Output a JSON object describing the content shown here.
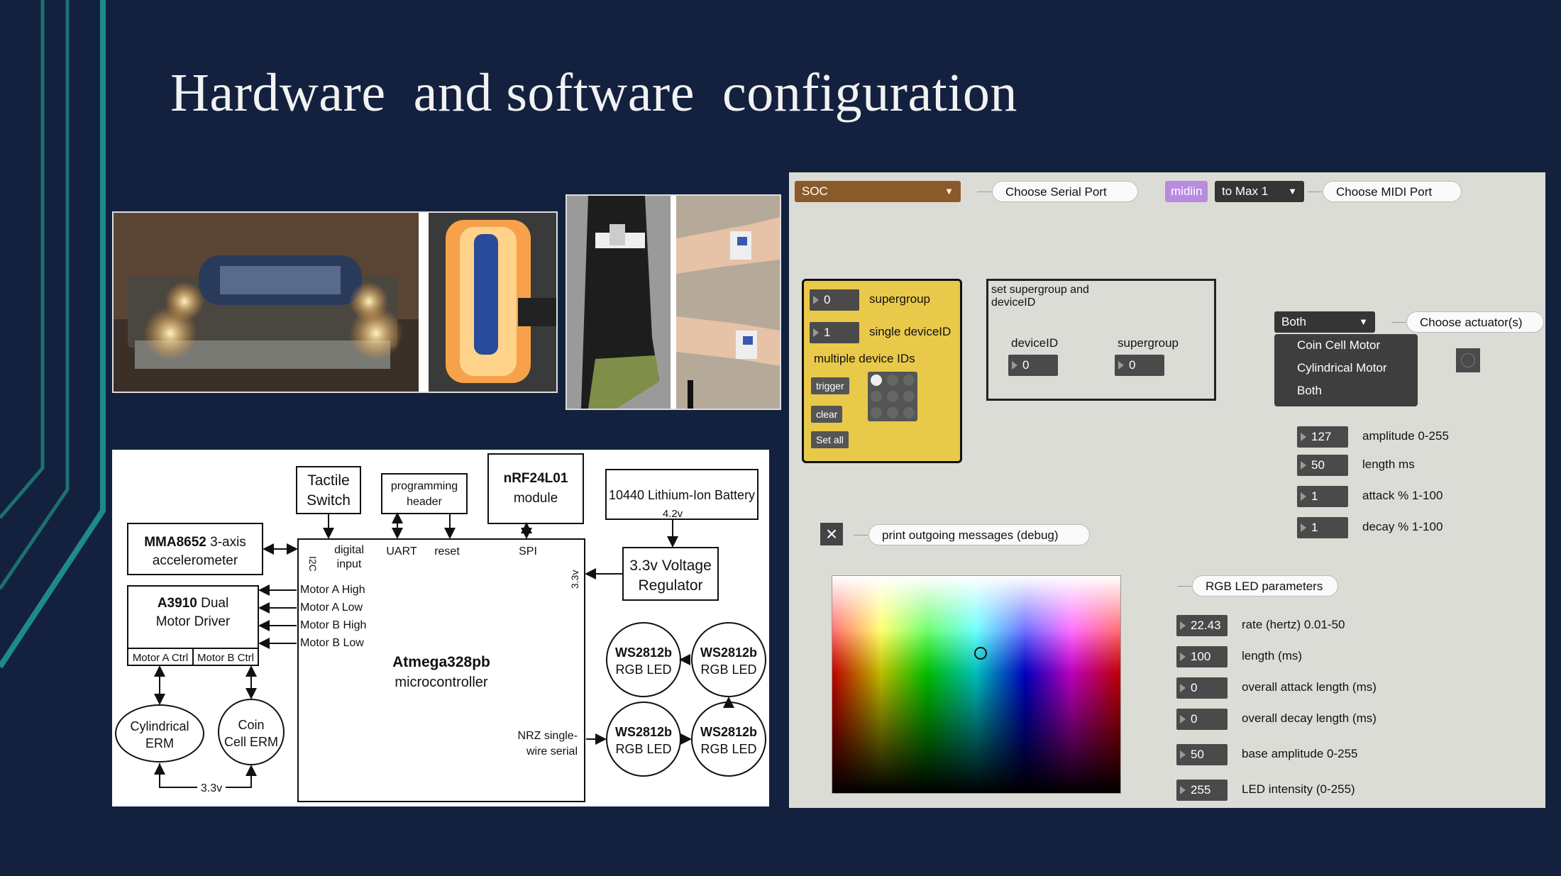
{
  "slide": {
    "title": "Hardware  and software  configuration"
  },
  "diagram": {
    "tactile_switch": [
      "Tactile",
      "Switch"
    ],
    "programming_header": [
      "programming",
      "header"
    ],
    "nrf_module": [
      "nRF24L01",
      "module"
    ],
    "battery": "10440 Lithium-Ion Battery",
    "battery_voltage": "4.2v",
    "accelerometer": [
      "MMA8652",
      " 3-axis",
      "accelerometer"
    ],
    "motor_driver": [
      "A3910",
      " Dual",
      "Motor Driver"
    ],
    "motor_a_ctrl": "Motor A Ctrl",
    "motor_b_ctrl": "Motor B Ctrl",
    "regulator": [
      "3.3v Voltage",
      "Regulator"
    ],
    "mcu": [
      "Atmega328pb",
      "microcontroller"
    ],
    "pins_top": {
      "digital_input": [
        "digital",
        "input"
      ],
      "uart": "UART",
      "reset": "reset",
      "spi": "SPI",
      "i2c": "I2C",
      "v33": "3.3v"
    },
    "motor_pins": [
      "Motor A High",
      "Motor A Low",
      "Motor B High",
      "Motor B Low"
    ],
    "cyl_erm": [
      "Cylindrical",
      "ERM"
    ],
    "coin_erm": [
      "Coin",
      "Cell ERM"
    ],
    "bottom_v": "3.3v",
    "nrz": [
      "NRZ single-",
      "wire serial"
    ],
    "led_name": "WS2812b",
    "led_sub": "RGB LED"
  },
  "patch": {
    "serial_menu": "SOC",
    "serial_comment": "Choose Serial Port",
    "midiin": "midiin",
    "midi_menu": "to Max 1",
    "midi_comment": "Choose MIDI Port",
    "supergroup_val": "0",
    "supergroup_lbl": "supergroup",
    "single_val": "1",
    "single_lbl": "single deviceID",
    "multi_lbl": "multiple device IDs",
    "trigger": "trigger",
    "clear": "clear",
    "set_all": "Set all",
    "set_box_title": [
      "set supergroup and",
      "deviceID"
    ],
    "deviceid_lbl": "deviceID",
    "deviceid_val": "0",
    "supergroup2_lbl": "supergroup",
    "supergroup2_val": "0",
    "actuator_menu": "Both",
    "actuator_comment": "Choose actuator(s)",
    "actuator_options": [
      "Coin Cell Motor",
      "Cylindrical Motor",
      "Both"
    ],
    "motor_params": [
      {
        "value": "127",
        "label": "amplitude  0-255"
      },
      {
        "value": "50",
        "label": "length ms"
      },
      {
        "value": "1",
        "label": "attack % 1-100"
      },
      {
        "value": "1",
        "label": "decay % 1-100"
      }
    ],
    "debug_comment": "print outgoing messages (debug)",
    "rgb_comment": "RGB LED parameters",
    "led_params": [
      {
        "value": "22.43",
        "label": "rate (hertz) 0.01-50"
      },
      {
        "value": "100",
        "label": "length (ms)"
      },
      {
        "value": "0",
        "label": "overall attack length (ms)"
      },
      {
        "value": "0",
        "label": "overall decay length (ms)"
      },
      {
        "value": "50",
        "label": "base amplitude  0-255"
      },
      {
        "value": "255",
        "label": "LED intensity (0-255)"
      }
    ]
  },
  "colors": {
    "background": "#13213f",
    "teal": "#1f7d7d",
    "patch_bg": "#dcdcd7",
    "yellow": "#e9c94a",
    "orange_menu": "#8b5a2b",
    "purple": "#b98be0"
  }
}
